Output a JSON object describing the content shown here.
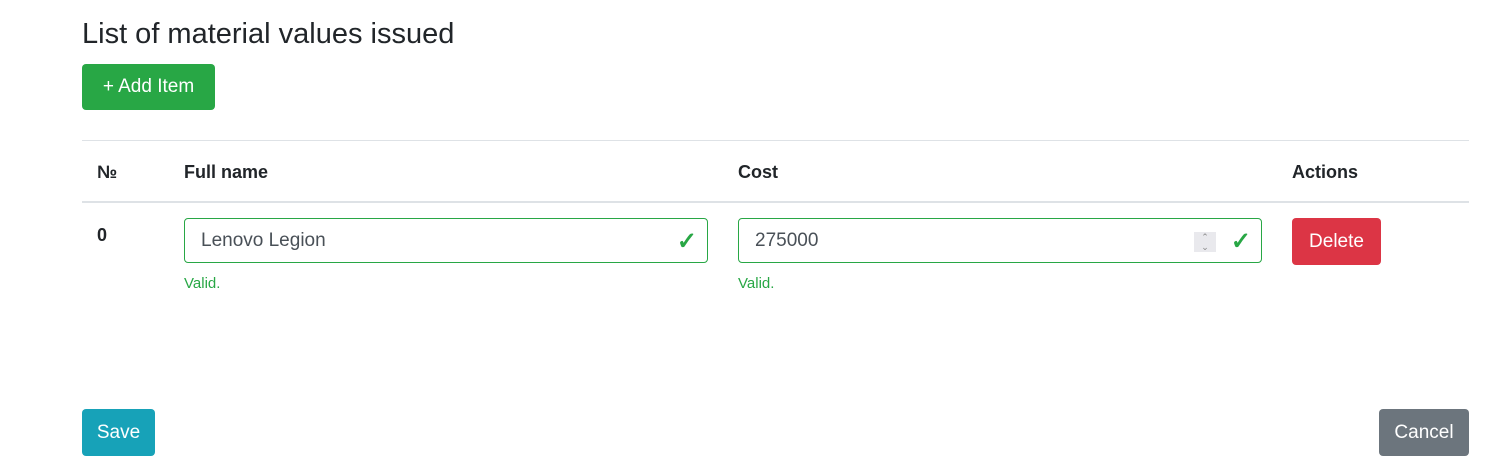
{
  "title": "List of material values issued",
  "add_label": "+ Add Item",
  "table": {
    "headers": [
      "№",
      "Full name",
      "Cost",
      "Actions"
    ],
    "rows": [
      {
        "index": "0",
        "full_name": "Lenovo Legion",
        "cost": "275000",
        "name_feedback": "Valid.",
        "cost_feedback": "Valid.",
        "delete_label": "Delete"
      }
    ]
  },
  "save_label": "Save",
  "cancel_label": "Cancel",
  "colors": {
    "success": "#28a745",
    "danger": "#dc3545",
    "info": "#17a2b8",
    "secondary": "#6c757d"
  }
}
